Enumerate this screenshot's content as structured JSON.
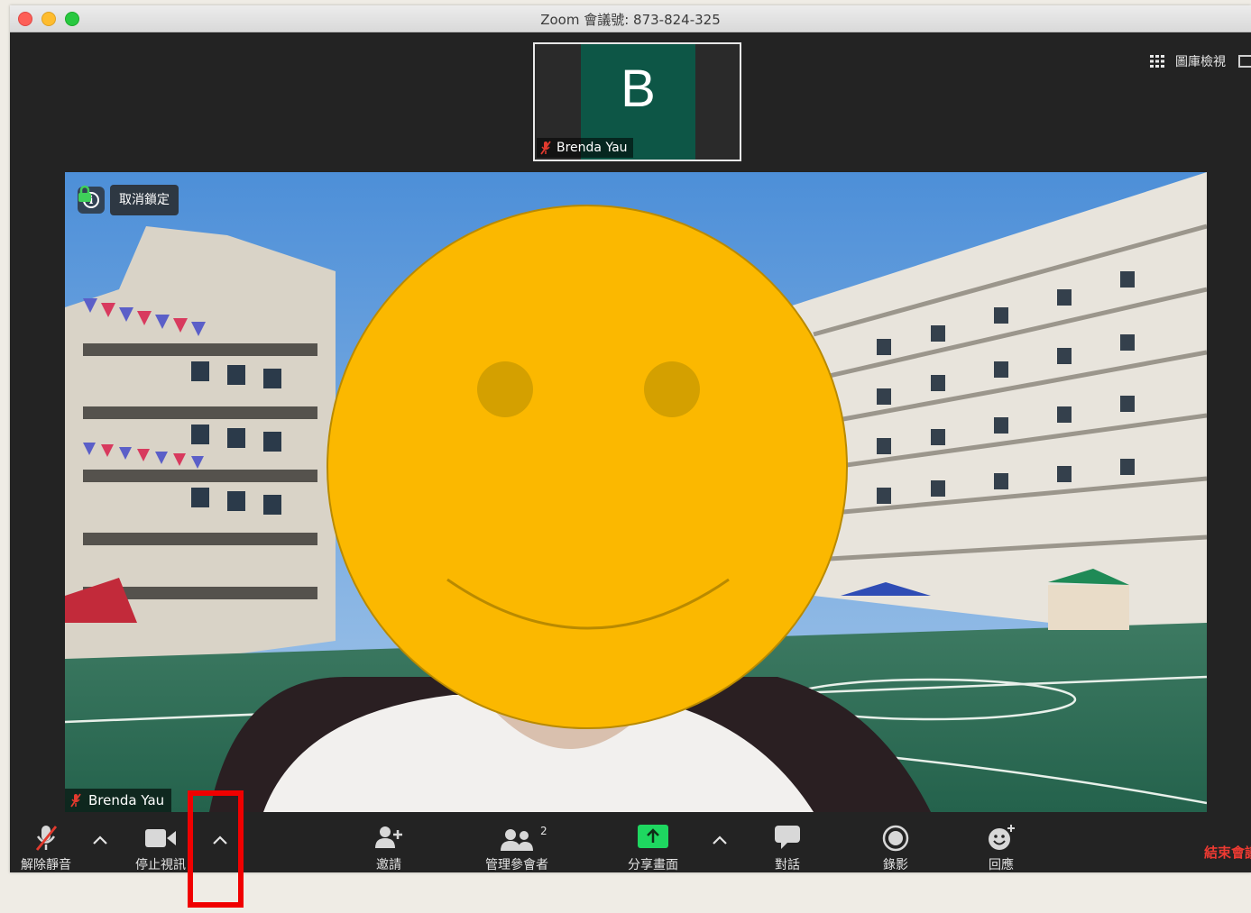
{
  "window": {
    "title": "Zoom 會議號: 873-824-325"
  },
  "header": {
    "gallery_view_label": "圖庫檢視"
  },
  "thumbnail": {
    "initial": "B",
    "name": "Brenda Yau"
  },
  "main_video": {
    "name": "Brenda Yau",
    "unpin_label": "取消鎖定"
  },
  "toolbar": {
    "unmute_label": "解除靜音",
    "stop_video_label": "停止視訊",
    "invite_label": "邀請",
    "participants_label": "管理參會者",
    "participants_count": "2",
    "share_label": "分享畫面",
    "chat_label": "對話",
    "record_label": "錄影",
    "reactions_label": "回應",
    "end_label": "結束會議"
  },
  "colors": {
    "share_green": "#1ed760",
    "end_red": "#ee3a32",
    "highlight_red": "#f00000",
    "avatar_tile": "#0d5646",
    "emoji_yellow": "#fbb800"
  }
}
